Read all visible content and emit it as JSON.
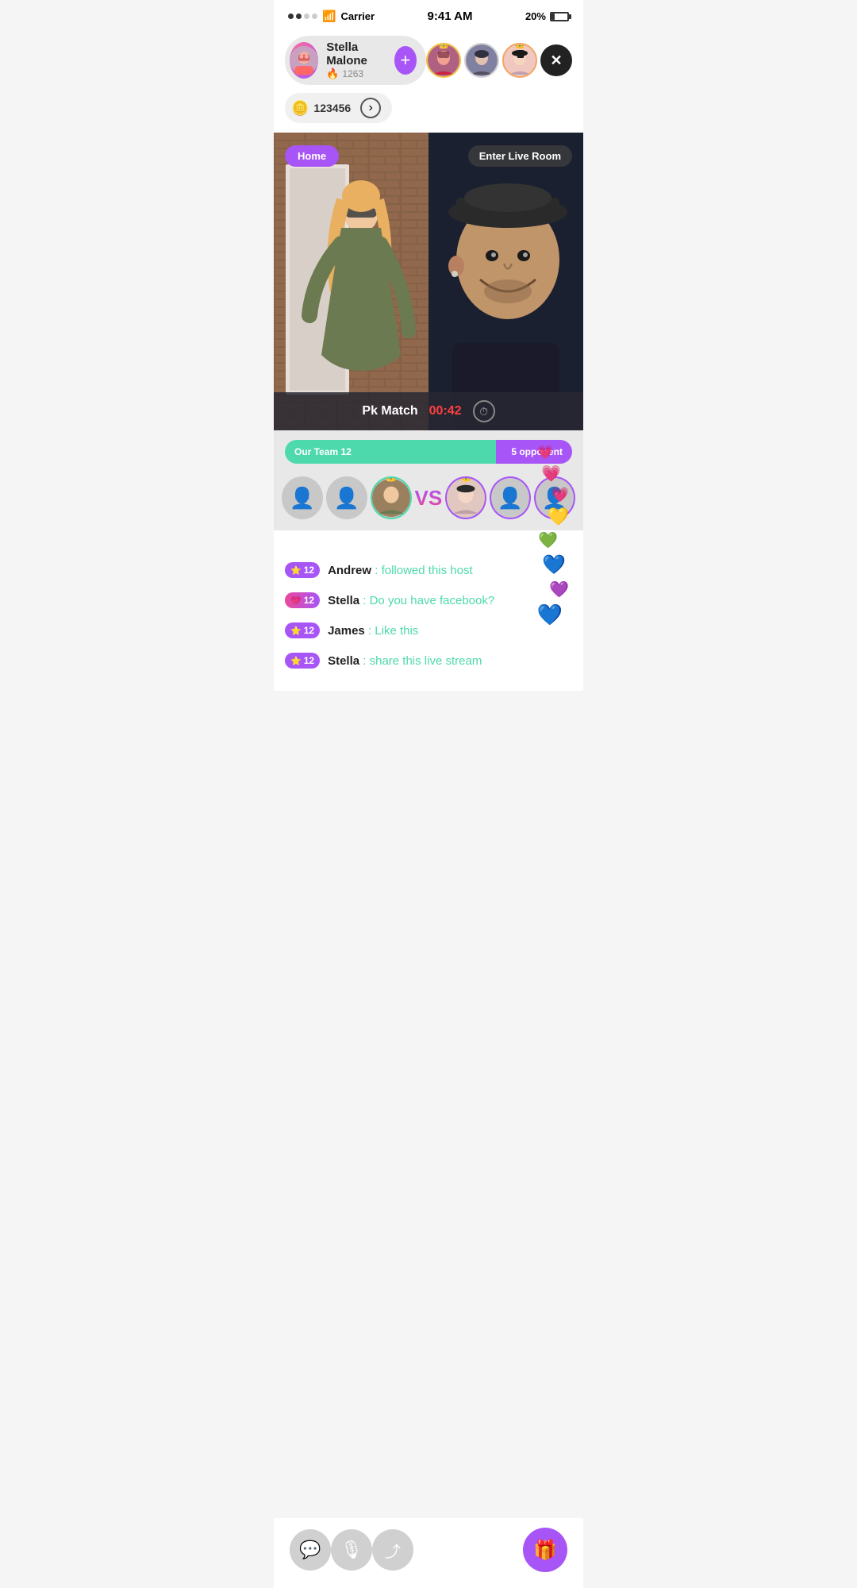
{
  "statusBar": {
    "carrier": "Carrier",
    "time": "9:41 AM",
    "battery": "20%",
    "signal": "●●○○○"
  },
  "profile": {
    "name": "Stella Malone",
    "flameScore": "1263",
    "addLabel": "+",
    "coins": "123456",
    "flameIcon": "🔥"
  },
  "avatars": [
    {
      "id": "av1",
      "crownColor": "gold"
    },
    {
      "id": "av2",
      "crownColor": "none"
    },
    {
      "id": "av3",
      "crownColor": "peach"
    }
  ],
  "liveSection": {
    "homeBadge": "Home",
    "enterLiveRoom": "Enter Live Room",
    "pkMatch": "Pk Match",
    "pkTime": "00:42"
  },
  "teamBar": {
    "ourTeam": "Our Team 12",
    "opponent": "5 opponent"
  },
  "chat": {
    "messages": [
      {
        "user": "Andrew",
        "level": "12",
        "icon": "⭐",
        "badgeType": "star",
        "message": " : followed this host"
      },
      {
        "user": "Stella",
        "level": "12",
        "icon": "💗",
        "badgeType": "heart",
        "message": " : Do you have facebook?"
      },
      {
        "user": "James",
        "level": "12",
        "icon": "⭐",
        "badgeType": "star",
        "message": " : Like this"
      },
      {
        "user": "Stella",
        "level": "12",
        "icon": "⭐",
        "badgeType": "star",
        "message": " : share this live stream"
      }
    ]
  },
  "bottomBar": {
    "chatIcon": "💬",
    "micIcon": "🎤",
    "shareIcon": "↗",
    "giftIcon": "🎁"
  },
  "hearts": [
    "💗",
    "💓",
    "💛",
    "💚",
    "💙",
    "💜"
  ]
}
